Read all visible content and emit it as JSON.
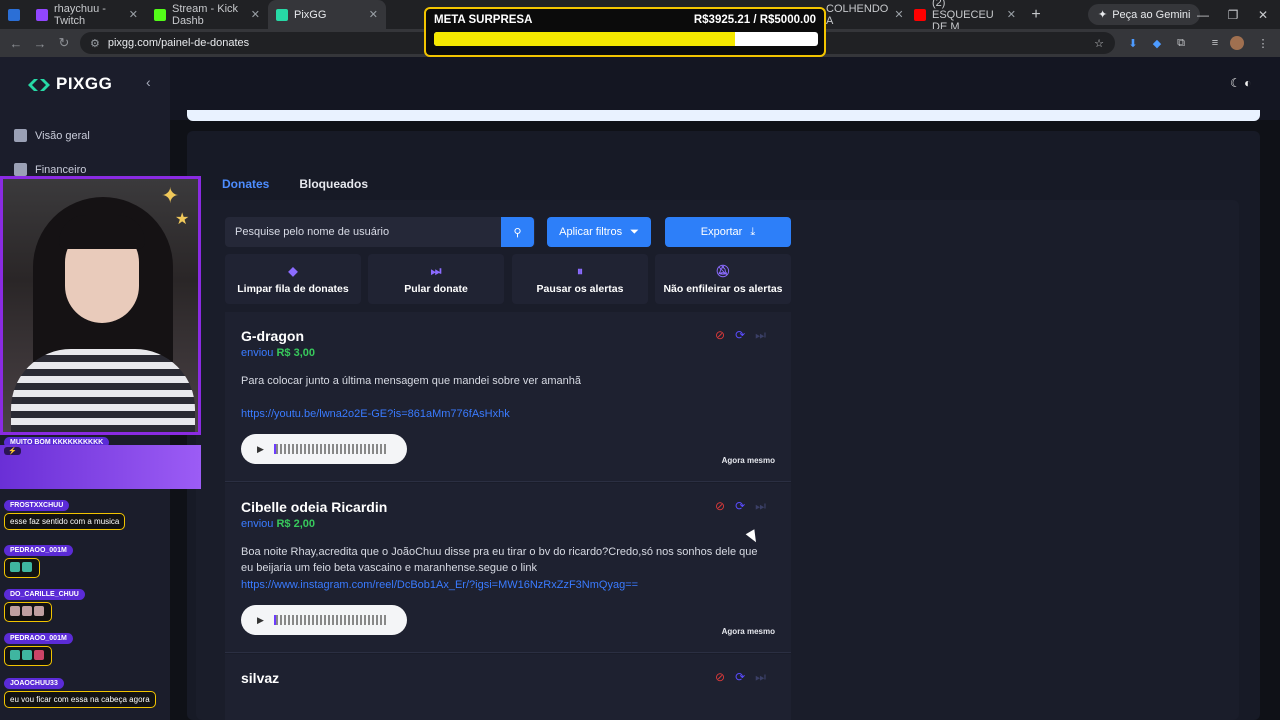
{
  "browser": {
    "tabs": [
      {
        "label": "rhaychuu - Twitch",
        "favicon_color": "#9146ff"
      },
      {
        "label": "Stream - Kick Dashb",
        "favicon_color": "#53fc18"
      },
      {
        "label": "PixGG",
        "favicon_color": "#27d9a6"
      },
      {
        "label": "COLHENDO A",
        "favicon_color": "#ffffff"
      },
      {
        "label": "(2) ESQUECEU DE M",
        "favicon_color": "#ff0000"
      }
    ],
    "gemini_label": "Peça ao Gemini",
    "url": "pixgg.com/painel-de-donates"
  },
  "meta": {
    "title": "META SURPRESA",
    "amount": "R$3925.21 / R$5000.00",
    "progress": 0.785
  },
  "sidebar": {
    "logo": "PIXGG",
    "items": [
      {
        "label": "Visão geral"
      },
      {
        "label": "Financeiro"
      }
    ]
  },
  "tabs": [
    {
      "label": "Donates",
      "active": true
    },
    {
      "label": "Bloqueados",
      "active": false
    }
  ],
  "search": {
    "placeholder": "Pesquise pelo nome de usuário"
  },
  "buttons": {
    "filters": "Aplicar filtros",
    "export": "Exportar"
  },
  "actions": [
    {
      "label": "Limpar fila de donates",
      "icon": "eraser-icon"
    },
    {
      "label": "Pular donate",
      "icon": "skip-icon"
    },
    {
      "label": "Pausar os alertas",
      "icon": "pause-icon"
    },
    {
      "label": "Não enfileirar os alertas",
      "icon": "bell-off-icon"
    }
  ],
  "donates": [
    {
      "name": "G-dragon",
      "sent_label": "enviou",
      "amount": "R$ 3,00",
      "message": "Para colocar junto a última mensagem que mandei sobre ver amanhã",
      "link": "https://youtu.be/lwna2o2E-GE?is=861aMm776fAsHxhk",
      "time": "Agora mesmo"
    },
    {
      "name": "Cibelle odeia Ricardin",
      "sent_label": "enviou",
      "amount": "R$ 2,00",
      "message": "Boa noite Rhay,acredita que o JoãoChuu disse pra eu tirar o bv do ricardo?Credo,só nos sonhos dele que eu beijaria um feio beta    vascaino e maranhense.segue o link",
      "link": "https://www.instagram.com/reel/DcBob1Ax_Er/?igsi=MW16NzRxZzF3NmQyag==",
      "time": "Agora mesmo"
    },
    {
      "name": "silvaz"
    }
  ],
  "stream_chat": [
    {
      "user": "MUITO BOM KKKKKKKKKK",
      "message": ""
    },
    {
      "user": "FROSTXXCHUU",
      "message": "esse faz sentido com a musica"
    },
    {
      "user": "PEDRAOO_001M",
      "message": ""
    },
    {
      "user": "DO_CARILLE_CHUU",
      "message": ""
    },
    {
      "user": "PEDRAOO_001M",
      "message": ""
    },
    {
      "user": "JOAOCHUU33",
      "message": "eu vou ficar com essa na cabeça agora"
    }
  ]
}
